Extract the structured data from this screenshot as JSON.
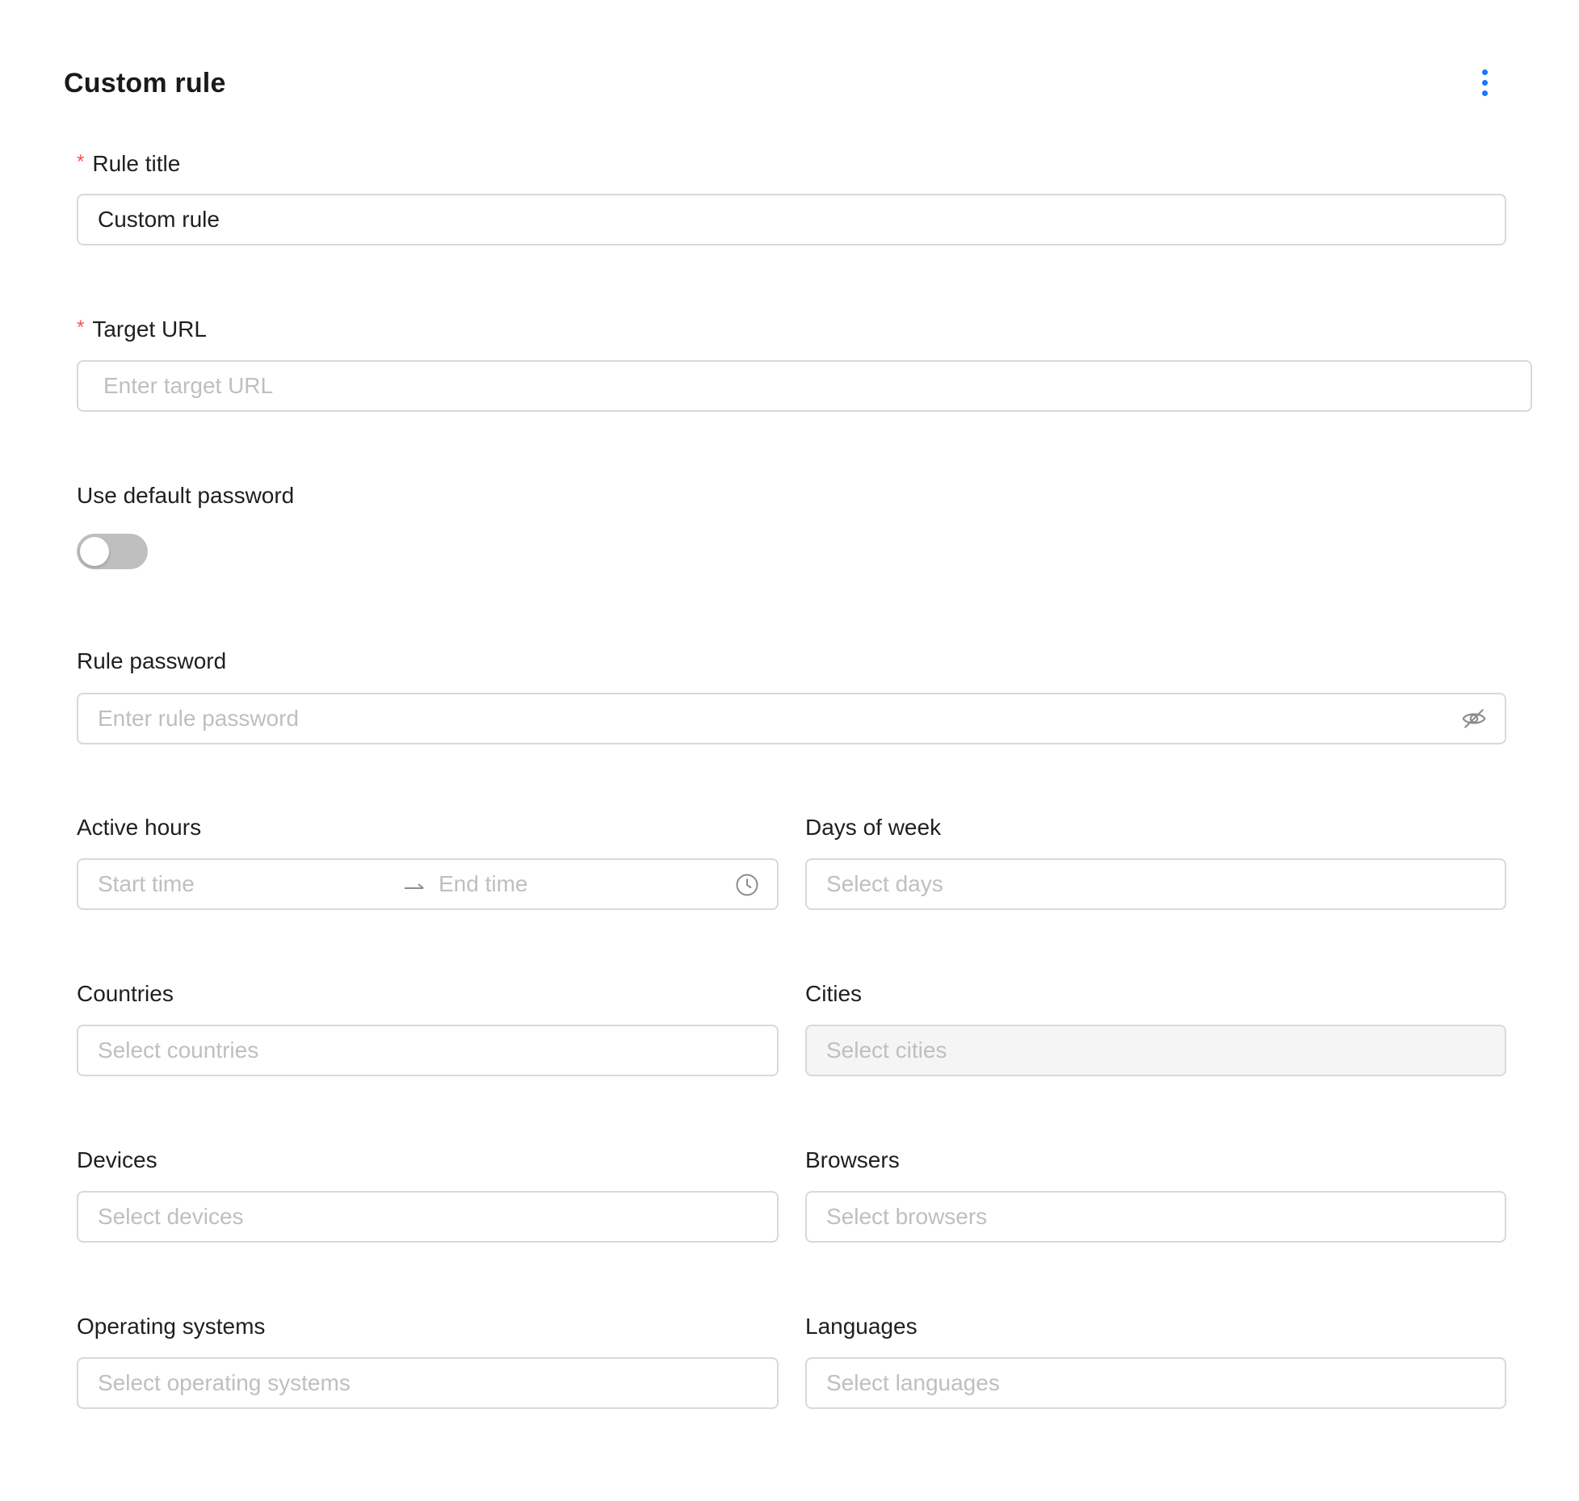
{
  "header": {
    "title": "Custom rule",
    "more_icon": "more-vertical-icon"
  },
  "fields": {
    "rule_title": {
      "label": "Rule title",
      "required": true,
      "value": "Custom rule"
    },
    "target_url": {
      "label": "Target URL",
      "required": true,
      "placeholder": "Enter target URL"
    },
    "use_default_password": {
      "label": "Use default password",
      "checked": false
    },
    "rule_password": {
      "label": "Rule password",
      "placeholder": "Enter rule password",
      "icon": "eye-invisible-icon"
    },
    "active_hours": {
      "label": "Active hours",
      "start_placeholder": "Start time",
      "end_placeholder": "End time",
      "separator": "→",
      "icon": "clock-icon"
    },
    "days_of_week": {
      "label": "Days of week",
      "placeholder": "Select days"
    },
    "countries": {
      "label": "Countries",
      "placeholder": "Select countries"
    },
    "cities": {
      "label": "Cities",
      "placeholder": "Select cities",
      "disabled": true
    },
    "devices": {
      "label": "Devices",
      "placeholder": "Select devices"
    },
    "browsers": {
      "label": "Browsers",
      "placeholder": "Select browsers"
    },
    "operating_systems": {
      "label": "Operating systems",
      "placeholder": "Select operating systems"
    },
    "languages": {
      "label": "Languages",
      "placeholder": "Select languages"
    }
  },
  "colors": {
    "accent": "#1677ff",
    "required": "#ff4d4f",
    "border": "#d9d9d9",
    "placeholder": "#bfbfbf",
    "toggle_off": "#bfbfbf",
    "disabled_bg": "#f5f5f5"
  }
}
